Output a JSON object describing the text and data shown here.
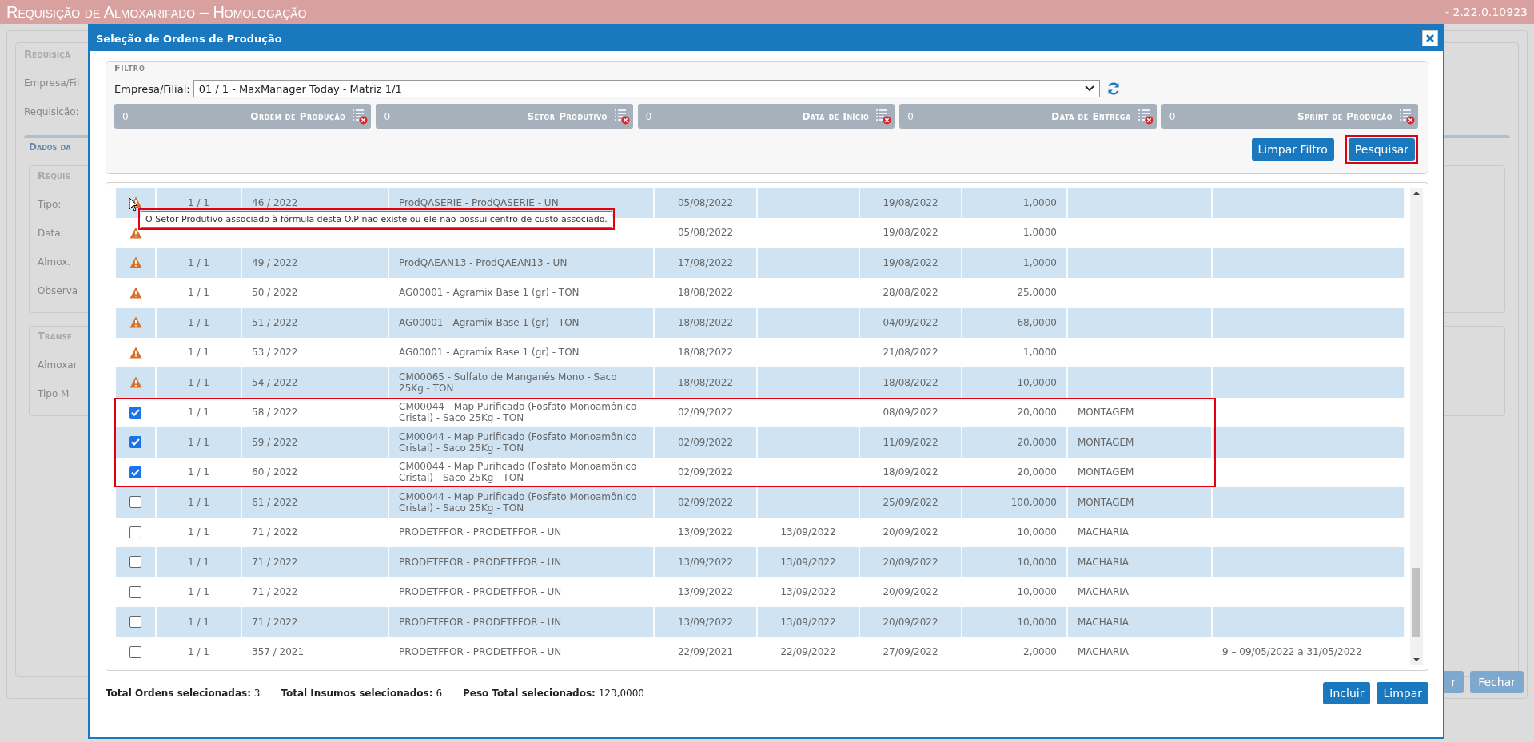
{
  "app": {
    "title": "Requisição de Almoxarifado – Homologação",
    "version": "- 2.22.0.10923"
  },
  "background": {
    "fieldset_title": "Requisiçã",
    "labels": [
      "Empresa/Fil",
      "Requisição:"
    ],
    "tab": "Dados da",
    "sections": [
      {
        "title": "Requis",
        "labels": [
          "Tipo:",
          "Data:",
          "Almox.",
          "Observa"
        ]
      },
      {
        "title": "Transf",
        "labels": [
          "Almoxar",
          "Tipo M"
        ]
      }
    ],
    "buttons": [
      "r",
      "Fechar"
    ]
  },
  "modal": {
    "title": "Seleção de Ordens de Produção",
    "filter": {
      "legend": "Filtro",
      "company_label": "Empresa/Filial:",
      "company_value": "01 / 1 - MaxManager Today - Matriz 1/1",
      "chips": [
        {
          "count": "0",
          "label": "Ordem de Produção"
        },
        {
          "count": "0",
          "label": "Setor Produtivo"
        },
        {
          "count": "0",
          "label": "Data de Início"
        },
        {
          "count": "0",
          "label": "Data de Entrega"
        },
        {
          "count": "0",
          "label": "Sprint de Produção"
        }
      ],
      "buttons": [
        {
          "label": "Limpar Filtro",
          "highlighted": false
        },
        {
          "label": "Pesquisar",
          "highlighted": true
        }
      ]
    },
    "rows": [
      {
        "kind": "warning",
        "highlighted": false,
        "cells": [
          "1 / 1",
          "46 / 2022",
          "ProdQASERIE - ProdQASERIE - UN",
          "05/08/2022",
          null,
          "19/08/2022",
          "1,0000",
          null,
          null
        ]
      },
      {
        "kind": "warning",
        "highlighted": false,
        "cells": [
          null,
          null,
          null,
          "05/08/2022",
          null,
          "19/08/2022",
          "1,0000",
          null,
          null
        ]
      },
      {
        "kind": "warning",
        "highlighted": false,
        "cells": [
          "1 / 1",
          "49 / 2022",
          "ProdQAEAN13 - ProdQAEAN13 - UN",
          "17/08/2022",
          null,
          "19/08/2022",
          "1,0000",
          null,
          null
        ]
      },
      {
        "kind": "warning",
        "highlighted": false,
        "cells": [
          "1 / 1",
          "50 / 2022",
          "AG00001 - Agramix Base 1 (gr) - TON",
          "18/08/2022",
          null,
          "28/08/2022",
          "25,0000",
          null,
          null
        ]
      },
      {
        "kind": "warning",
        "highlighted": false,
        "cells": [
          "1 / 1",
          "51 / 2022",
          "AG00001 - Agramix Base 1 (gr) - TON",
          "18/08/2022",
          null,
          "04/09/2022",
          "68,0000",
          null,
          null
        ]
      },
      {
        "kind": "warning",
        "highlighted": false,
        "cells": [
          "1 / 1",
          "53 / 2022",
          "AG00001 - Agramix Base 1 (gr) - TON",
          "18/08/2022",
          null,
          "21/08/2022",
          "1,0000",
          null,
          null
        ]
      },
      {
        "kind": "warning",
        "highlighted": false,
        "cells": [
          "1 / 1",
          "54 / 2022",
          "CM00065 - Sulfato de Manganês Mono - Saco 25Kg - TON",
          "18/08/2022",
          null,
          "18/08/2022",
          "10,0000",
          null,
          null
        ]
      },
      {
        "kind": "checkbox",
        "checked": true,
        "highlighted": true,
        "cells": [
          "1 / 1",
          "58 / 2022",
          "CM00044 - Map Purificado (Fosfato Monoamônico Cristal) - Saco 25Kg - TON",
          "02/09/2022",
          null,
          "08/09/2022",
          "20,0000",
          "MONTAGEM",
          null
        ]
      },
      {
        "kind": "checkbox",
        "checked": true,
        "highlighted": true,
        "cells": [
          "1 / 1",
          "59 / 2022",
          "CM00044 - Map Purificado (Fosfato Monoamônico Cristal) - Saco 25Kg - TON",
          "02/09/2022",
          null,
          "11/09/2022",
          "20,0000",
          "MONTAGEM",
          null
        ]
      },
      {
        "kind": "checkbox",
        "checked": true,
        "highlighted": true,
        "cells": [
          "1 / 1",
          "60 / 2022",
          "CM00044 - Map Purificado (Fosfato Monoamônico Cristal) - Saco 25Kg - TON",
          "02/09/2022",
          null,
          "18/09/2022",
          "20,0000",
          "MONTAGEM",
          null
        ]
      },
      {
        "kind": "checkbox",
        "checked": false,
        "highlighted": false,
        "cells": [
          "1 / 1",
          "61 / 2022",
          "CM00044 - Map Purificado (Fosfato Monoamônico Cristal) - Saco 25Kg - TON",
          "02/09/2022",
          null,
          "25/09/2022",
          "100,0000",
          "MONTAGEM",
          null
        ]
      },
      {
        "kind": "checkbox",
        "checked": false,
        "highlighted": false,
        "cells": [
          "1 / 1",
          "71 / 2022",
          "PRODETFFOR - PRODETFFOR - UN",
          "13/09/2022",
          "13/09/2022",
          "20/09/2022",
          "10,0000",
          "MACHARIA",
          null
        ]
      },
      {
        "kind": "checkbox",
        "checked": false,
        "highlighted": false,
        "cells": [
          "1 / 1",
          "71 / 2022",
          "PRODETFFOR - PRODETFFOR - UN",
          "13/09/2022",
          "13/09/2022",
          "20/09/2022",
          "10,0000",
          "MACHARIA",
          null
        ]
      },
      {
        "kind": "checkbox",
        "checked": false,
        "highlighted": false,
        "cells": [
          "1 / 1",
          "71 / 2022",
          "PRODETFFOR - PRODETFFOR - UN",
          "13/09/2022",
          "13/09/2022",
          "20/09/2022",
          "10,0000",
          "MACHARIA",
          null
        ]
      },
      {
        "kind": "checkbox",
        "checked": false,
        "highlighted": false,
        "cells": [
          "1 / 1",
          "71 / 2022",
          "PRODETFFOR - PRODETFFOR - UN",
          "13/09/2022",
          "13/09/2022",
          "20/09/2022",
          "10,0000",
          "MACHARIA",
          null
        ]
      },
      {
        "kind": "checkbox",
        "checked": false,
        "highlighted": false,
        "cells": [
          "1 / 1",
          "357 / 2021",
          "PRODETFFOR - PRODETFFOR - UN",
          "22/09/2021",
          "22/09/2022",
          "27/09/2022",
          "2,0000",
          "MACHARIA",
          "9 – 09/05/2022 a 31/05/2022"
        ]
      }
    ],
    "tooltip": {
      "text": "O Setor Produtivo associado à fórmula desta O.P não existe ou ele não possui centro de custo associado.",
      "highlighted": true
    },
    "footer": {
      "totals": [
        {
          "label": "Total Ordens selecionadas:",
          "value": "3"
        },
        {
          "label": "Total Insumos selecionados:",
          "value": "6"
        },
        {
          "label": "Peso Total selecionados:",
          "value": "123,0000"
        }
      ],
      "buttons": [
        "Incluir",
        "Limpar"
      ]
    }
  }
}
